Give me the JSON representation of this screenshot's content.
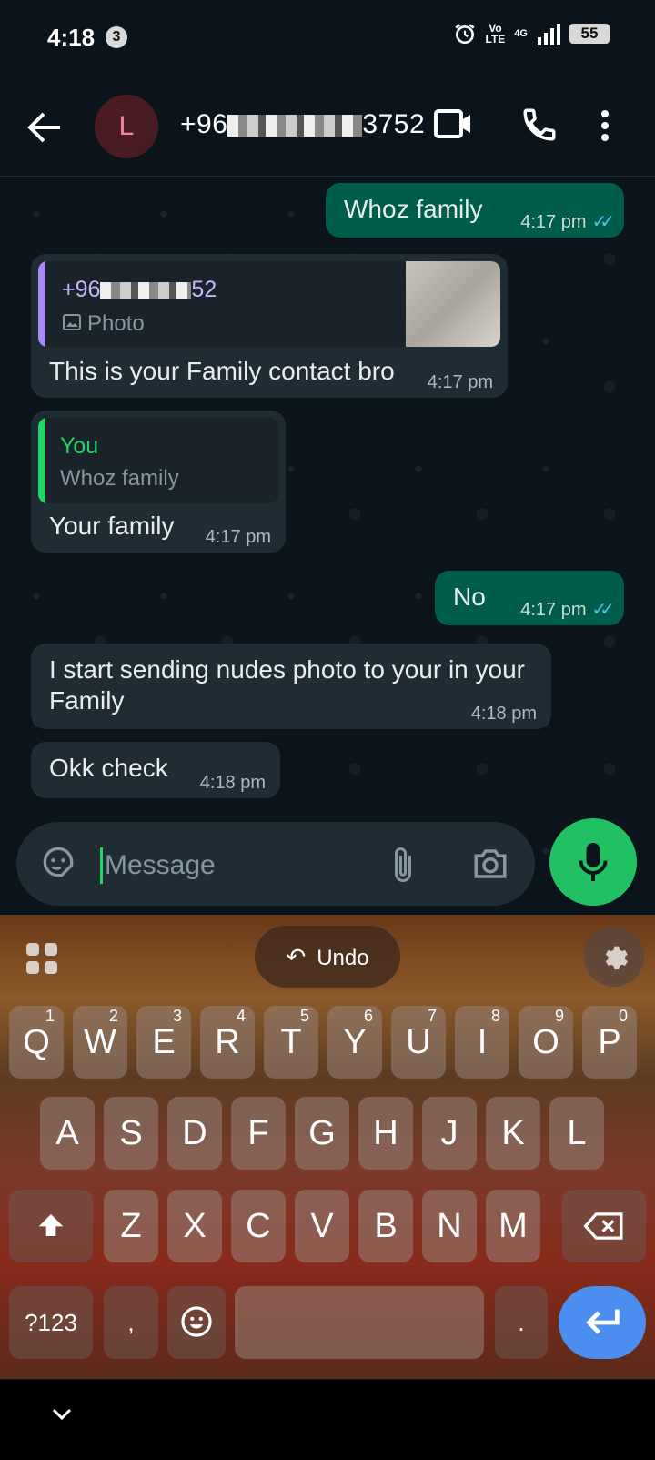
{
  "status_bar": {
    "time": "4:18",
    "notification_count": "3",
    "volte": "Vo\nLTE",
    "network": "4G",
    "battery": "55"
  },
  "header": {
    "avatar_letter": "L",
    "contact_prefix": "+96",
    "contact_suffix": "3752"
  },
  "messages": [
    {
      "id": "m1",
      "text": "Whoz family",
      "time": "4:17 pm",
      "ticks": "✓✓"
    },
    {
      "id": "m2",
      "quote_name_prefix": "+96",
      "quote_name_suffix": "52",
      "quote_sub": "Photo",
      "text": "This is your Family contact bro",
      "time": "4:17 pm"
    },
    {
      "id": "m3",
      "quote_name": "You",
      "quote_sub": "Whoz family",
      "text": "Your family",
      "time": "4:17 pm"
    },
    {
      "id": "m4",
      "text": "No",
      "time": "4:17 pm",
      "ticks": "✓✓"
    },
    {
      "id": "m5",
      "text": "I start sending nudes photo to your in your Family",
      "time": "4:18 pm"
    },
    {
      "id": "m6",
      "text": "Okk check",
      "time": "4:18 pm"
    }
  ],
  "composer": {
    "placeholder": "Message"
  },
  "keyboard": {
    "undo_label": "Undo",
    "row1": [
      {
        "k": "Q",
        "n": "1"
      },
      {
        "k": "W",
        "n": "2"
      },
      {
        "k": "E",
        "n": "3"
      },
      {
        "k": "R",
        "n": "4"
      },
      {
        "k": "T",
        "n": "5"
      },
      {
        "k": "Y",
        "n": "6"
      },
      {
        "k": "U",
        "n": "7"
      },
      {
        "k": "I",
        "n": "8"
      },
      {
        "k": "O",
        "n": "9"
      },
      {
        "k": "P",
        "n": "0"
      }
    ],
    "row2": [
      "A",
      "S",
      "D",
      "F",
      "G",
      "H",
      "J",
      "K",
      "L"
    ],
    "row3": [
      "Z",
      "X",
      "C",
      "V",
      "B",
      "N",
      "M"
    ],
    "symbols_label": "?123",
    "comma": ",",
    "period": "."
  },
  "colors": {
    "incoming": "#202c33",
    "outgoing": "#005c4b",
    "accent": "#21c063",
    "quote_other": "#a78bfa",
    "quote_you": "#25d366"
  }
}
